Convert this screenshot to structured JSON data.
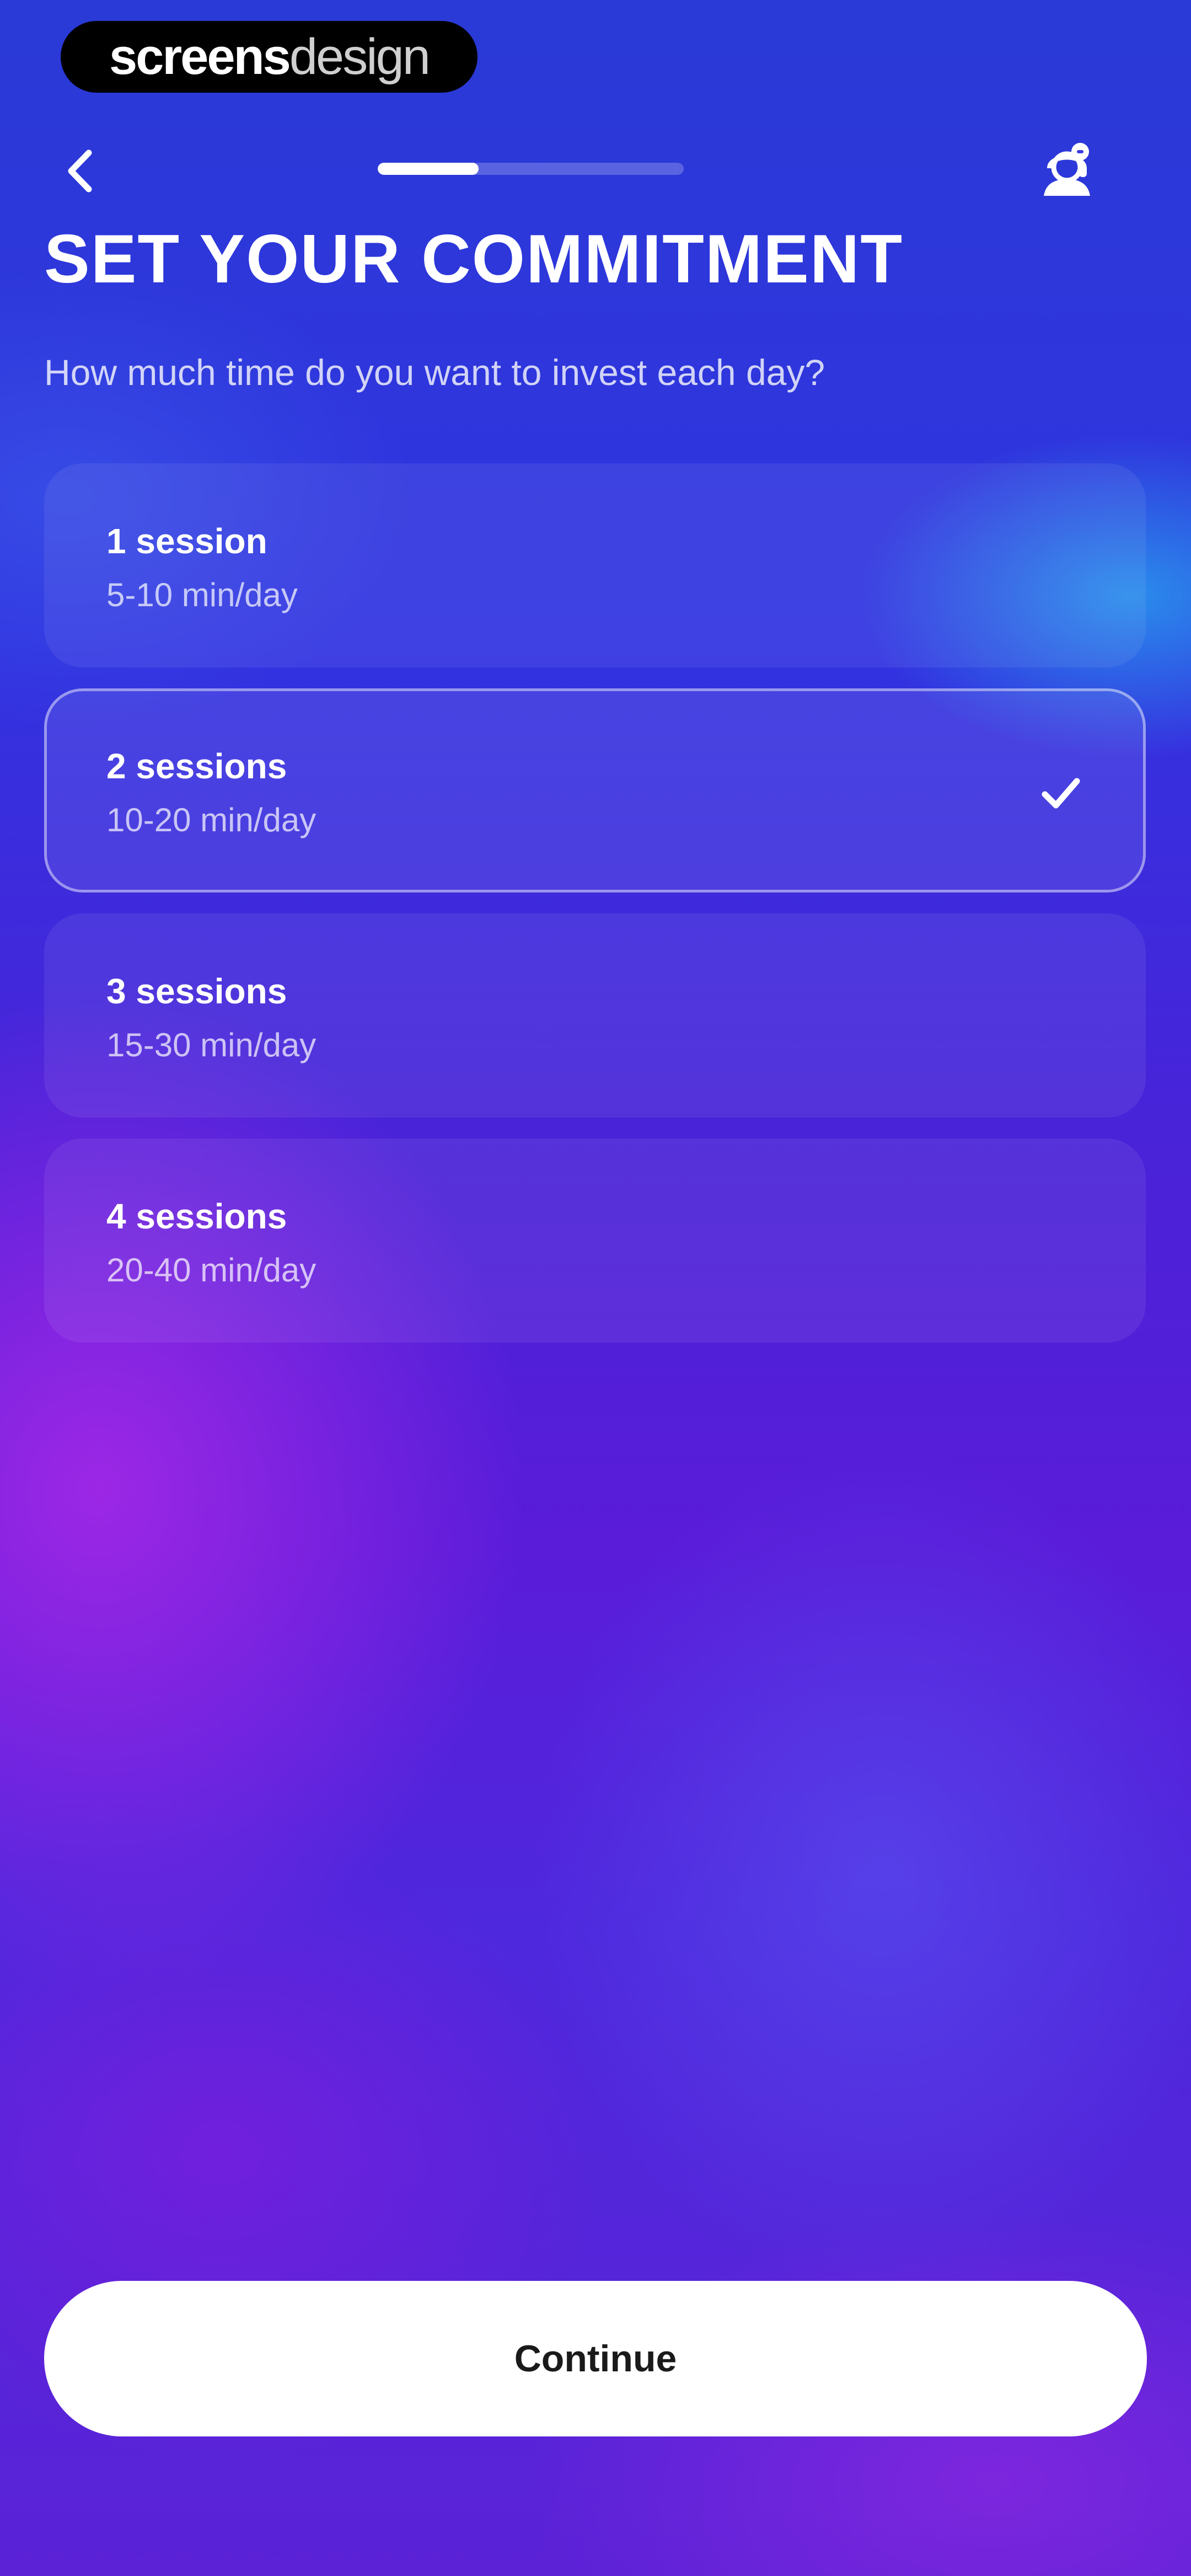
{
  "watermark": {
    "bold_text": "screens",
    "light_text": "design"
  },
  "nav": {
    "back_icon": "chevron-left-icon",
    "support_icon": "support-headset-icon",
    "progress_fraction": 0.33
  },
  "header": {
    "title": "SET YOUR COMMITMENT",
    "subtitle": "How much time do you want to invest each day?"
  },
  "options": [
    {
      "title": "1 session",
      "subtitle": "5-10 min/day",
      "selected": false
    },
    {
      "title": "2 sessions",
      "subtitle": "10-20 min/day",
      "selected": true
    },
    {
      "title": "3 sessions",
      "subtitle": "15-30 min/day",
      "selected": false
    },
    {
      "title": "4 sessions",
      "subtitle": "20-40 min/day",
      "selected": false
    }
  ],
  "footer": {
    "continue_label": "Continue"
  },
  "colors": {
    "background_top": "#2a3ad6",
    "background_bottom": "#5b22d6",
    "button_bg": "#ffffff",
    "button_text": "#1a1a1a"
  }
}
